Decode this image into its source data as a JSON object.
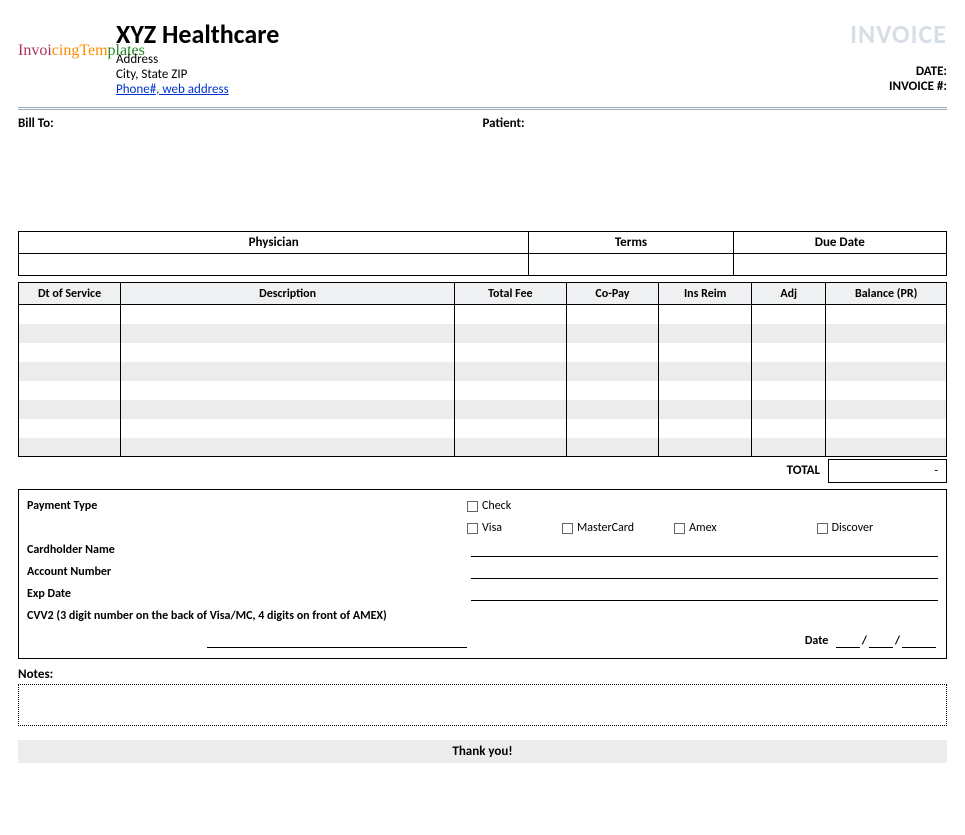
{
  "company": {
    "name": "XYZ Healthcare",
    "address_line1": "Address",
    "address_line2": "City, State ZIP",
    "contact_link": "Phone#, web address"
  },
  "logo_text": "InvoicingTemplates",
  "doc_title": "INVOICE",
  "meta": {
    "date_label": "DATE:",
    "invoice_no_label": "INVOICE #:"
  },
  "parties": {
    "bill_to_label": "Bill To:",
    "patient_label": "Patient:"
  },
  "top_table": {
    "physician_hdr": "Physician",
    "terms_hdr": "Terms",
    "due_date_hdr": "Due Date"
  },
  "items": {
    "headers": {
      "dt_of_service": "Dt of Service",
      "description": "Description",
      "total_fee": "Total Fee",
      "co_pay": "Co-Pay",
      "ins_reim": "Ins Reim",
      "adj": "Adj",
      "balance_pr": "Balance (PR)"
    },
    "row_count": 8,
    "total_label": "TOTAL",
    "total_value": "-"
  },
  "payment": {
    "section_label": "Payment Type",
    "options": {
      "check": "Check",
      "visa": "Visa",
      "mastercard": "MasterCard",
      "amex": "Amex",
      "discover": "Discover"
    },
    "cardholder_name_label": "Cardholder Name",
    "account_number_label": "Account Number",
    "exp_date_label": "Exp Date",
    "cvv2_label": "CVV2 (3 digit number on the back of Visa/MC, 4 digits on front of AMEX)",
    "date_label": "Date",
    "date_template": "__/__/___"
  },
  "notes_label": "Notes:",
  "footer": "Thank you!"
}
